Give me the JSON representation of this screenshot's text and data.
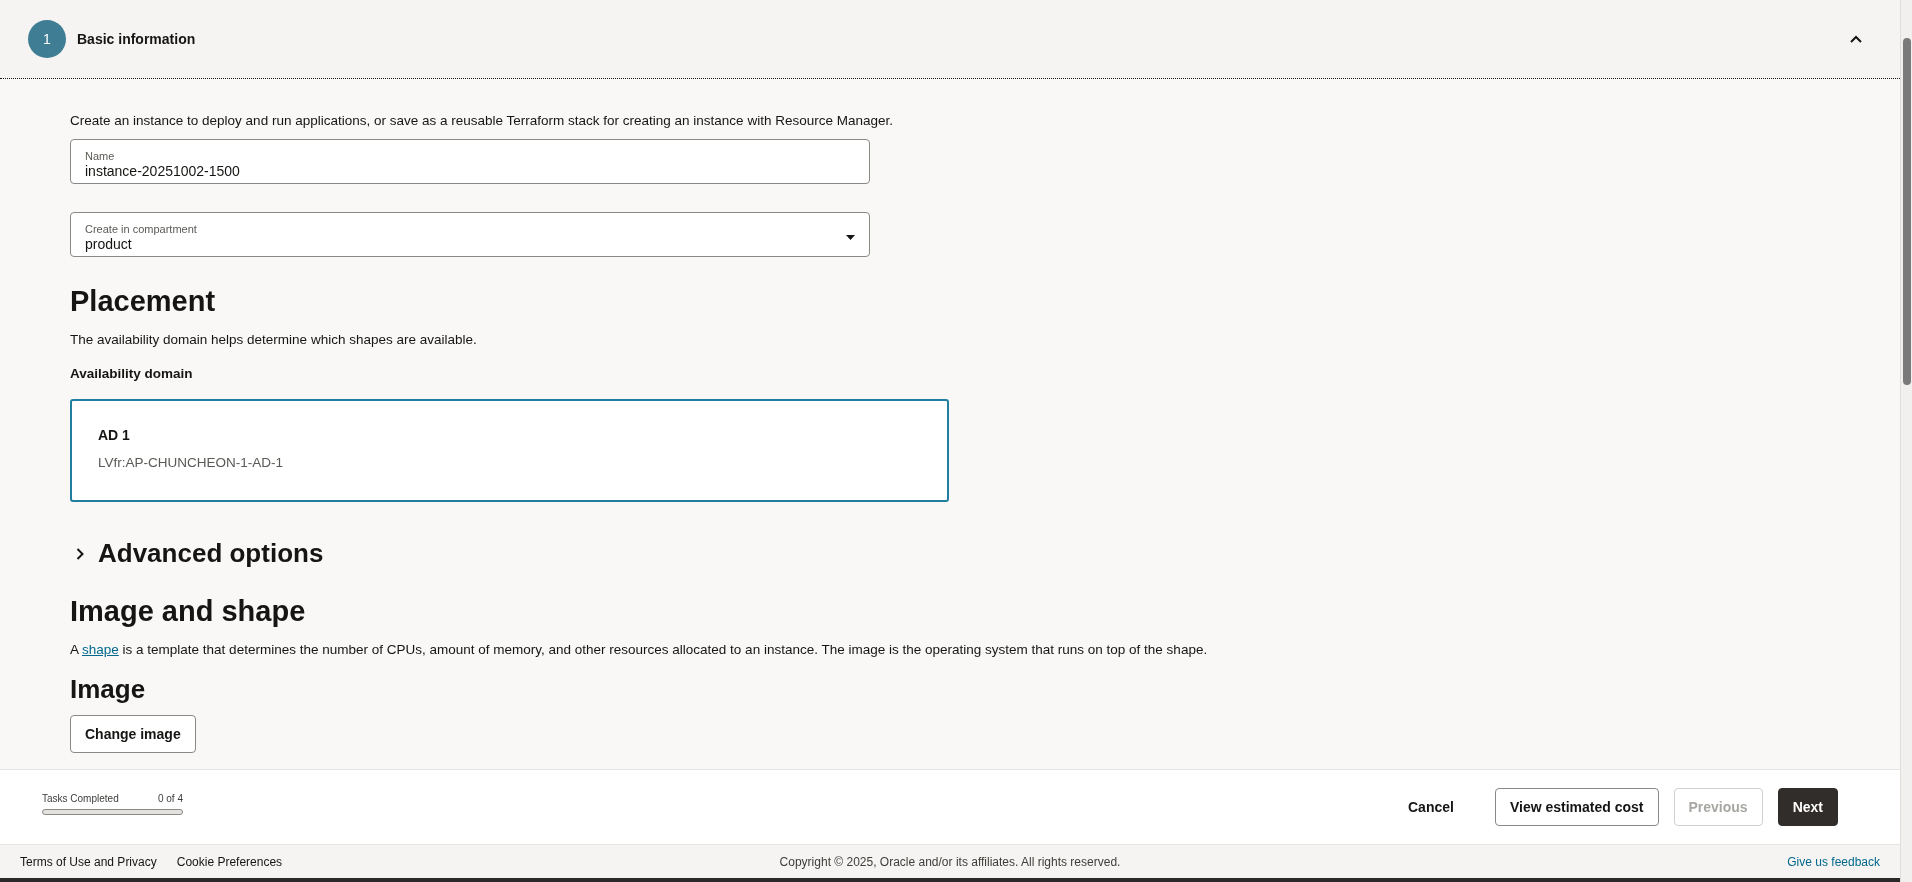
{
  "step": {
    "number": "1",
    "title": "Basic information",
    "expanded": true
  },
  "intro": "Create an instance to deploy and run applications, or save as a reusable Terraform stack for creating an instance with Resource Manager.",
  "fields": [
    {
      "kind": "text",
      "label": "Name",
      "value": "instance-20251002-1500"
    },
    {
      "kind": "select",
      "label": "Create in compartment",
      "value": "product"
    }
  ],
  "placement": {
    "heading": "Placement",
    "description": "The availability domain helps determine which shapes are available.",
    "label": "Availability domain",
    "domains": [
      {
        "name": "AD 1",
        "id": "LVfr:AP-CHUNCHEON-1-AD-1",
        "selected": true
      }
    ]
  },
  "advanced": {
    "label": "Advanced options",
    "expanded": false
  },
  "image_and_shape": {
    "heading": "Image and shape",
    "description_before": "A ",
    "link": "shape",
    "description_after": " is a template that determines the number of CPUs, amount of memory, and other resources allocated to an instance. The image is the operating system that runs on top of the shape.",
    "subheading": "Image",
    "button": "Change image"
  },
  "progress": {
    "label": "Tasks Completed",
    "count": "0 of 4",
    "level": 0
  },
  "actions": [
    {
      "kind": "link",
      "label": "Cancel",
      "disabled": false
    },
    {
      "kind": "outline",
      "label": "View estimated cost",
      "disabled": false
    },
    {
      "kind": "outline",
      "label": "Previous",
      "disabled": true
    },
    {
      "kind": "primary",
      "label": "Next",
      "disabled": false
    }
  ],
  "footer": {
    "links": [
      "Terms of Use and Privacy",
      "Cookie Preferences"
    ],
    "copyright": "Copyright © 2025, Oracle and/or its affiliates. All rights reserved.",
    "feedback": "Give us feedback"
  }
}
